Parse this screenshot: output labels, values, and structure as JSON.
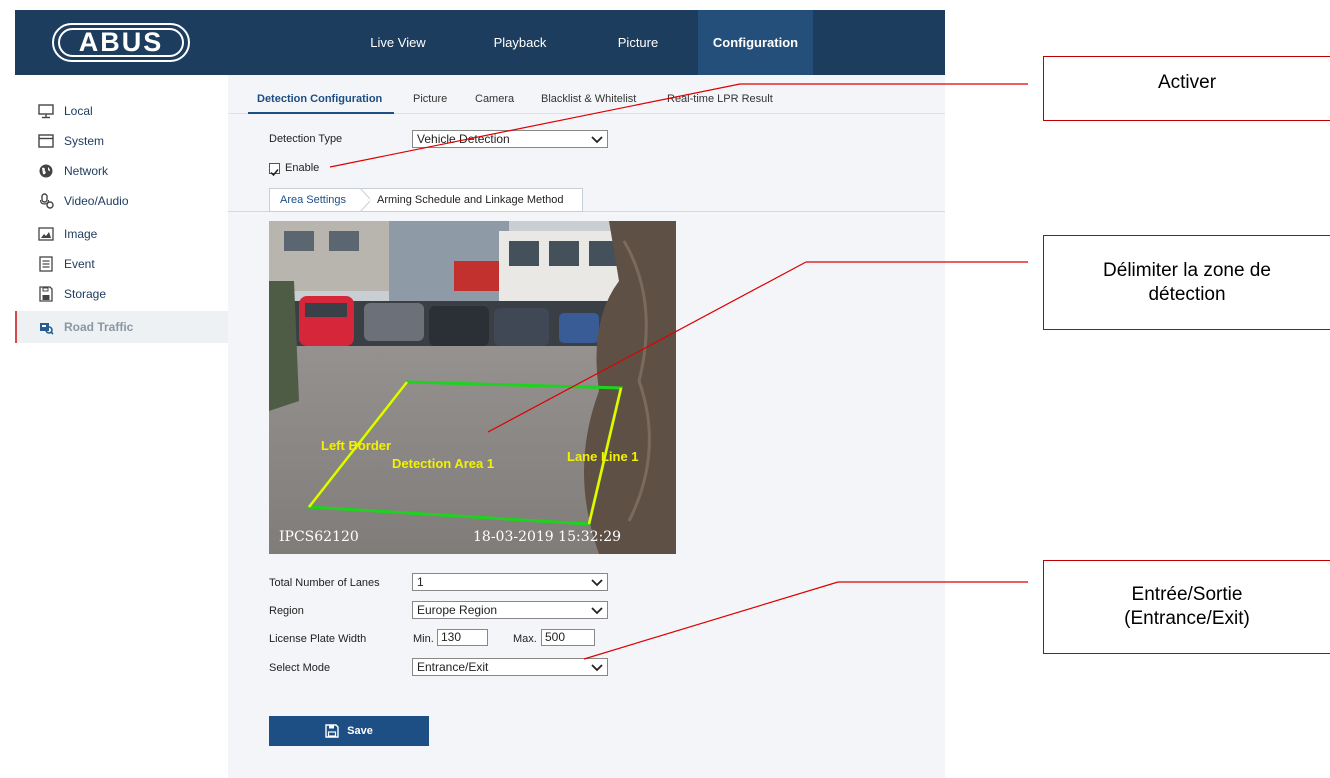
{
  "brand": {
    "logo_text": "ABUS"
  },
  "nav": [
    {
      "label": "Live View"
    },
    {
      "label": "Playback"
    },
    {
      "label": "Picture"
    },
    {
      "label": "Configuration"
    }
  ],
  "sidebar": {
    "items": [
      {
        "label": "Local",
        "icon": "monitor-icon"
      },
      {
        "label": "System",
        "icon": "window-icon"
      },
      {
        "label": "Network",
        "icon": "globe-icon"
      },
      {
        "label": "Video/Audio",
        "icon": "microphone-icon"
      },
      {
        "label": "Image",
        "icon": "image-icon"
      },
      {
        "label": "Event",
        "icon": "list-icon"
      },
      {
        "label": "Storage",
        "icon": "storage-icon"
      },
      {
        "label": "Road Traffic",
        "icon": "road-traffic-icon"
      }
    ]
  },
  "tabs": [
    {
      "label": "Detection Configuration"
    },
    {
      "label": "Picture"
    },
    {
      "label": "Camera"
    },
    {
      "label": "Blacklist & Whitelist"
    },
    {
      "label": "Real-time LPR Result"
    }
  ],
  "form": {
    "detection_type_label": "Detection Type",
    "detection_type_value": "Vehicle Detection",
    "enable_label": "Enable",
    "enable_checked": true,
    "subtabs": [
      {
        "label": "Area Settings"
      },
      {
        "label": "Arming Schedule and Linkage Method"
      }
    ],
    "lanes_label": "Total Number of Lanes",
    "lanes_value": "1",
    "region_label": "Region",
    "region_value": "Europe Region",
    "plate_width_label": "License Plate Width",
    "min_label": "Min.",
    "min_value": "130",
    "max_label": "Max.",
    "max_value": "500",
    "mode_label": "Select Mode",
    "mode_value": "Entrance/Exit",
    "save_label": "Save"
  },
  "video": {
    "camera_name": "IPCS62120",
    "timestamp": "18-03-2019 15:32:29",
    "left_border": "Left Border",
    "detection_area": "Detection Area 1",
    "lane_line": "Lane Line 1",
    "region_color": "#1fd21f",
    "line_color": "#f2f200"
  },
  "callouts": {
    "activate": "Activer",
    "zone": [
      "Délimiter la zone de",
      "détection"
    ],
    "mode": [
      "Entrée/Sortie",
      "(Entrance/Exit)"
    ],
    "line_color": "#dd0000"
  }
}
